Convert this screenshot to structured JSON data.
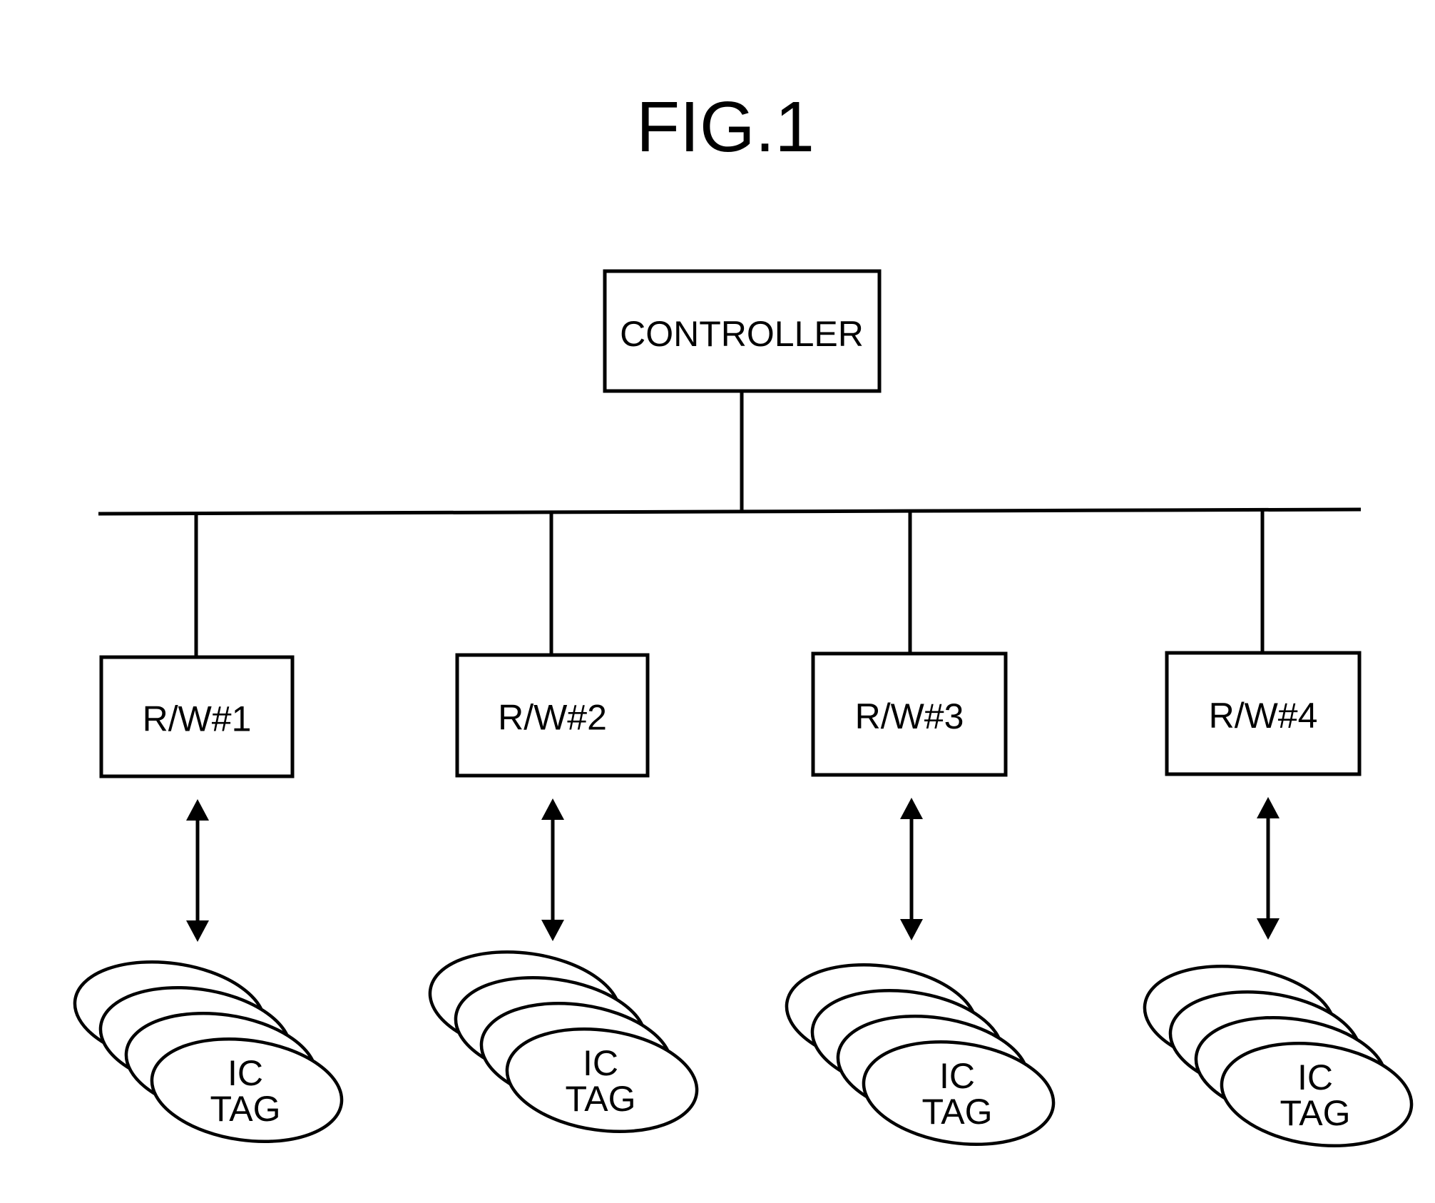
{
  "figure": {
    "title": "FIG.1",
    "controller": {
      "label": "CONTROLLER"
    },
    "readers": [
      {
        "label": "R/W#1",
        "tag_label_line1": "IC",
        "tag_label_line2": "TAG",
        "tag_count": 4
      },
      {
        "label": "R/W#2",
        "tag_label_line1": "IC",
        "tag_label_line2": "TAG",
        "tag_count": 4
      },
      {
        "label": "R/W#3",
        "tag_label_line1": "IC",
        "tag_label_line2": "TAG",
        "tag_count": 4
      },
      {
        "label": "R/W#4",
        "tag_label_line1": "IC",
        "tag_label_line2": "TAG",
        "tag_count": 4
      }
    ],
    "connections": {
      "controller_to_bus": "line",
      "bus_to_readers": "line",
      "reader_to_tags": "bidirectional-arrow"
    },
    "colors": {
      "ink": "#000000",
      "paper": "#ffffff"
    }
  }
}
